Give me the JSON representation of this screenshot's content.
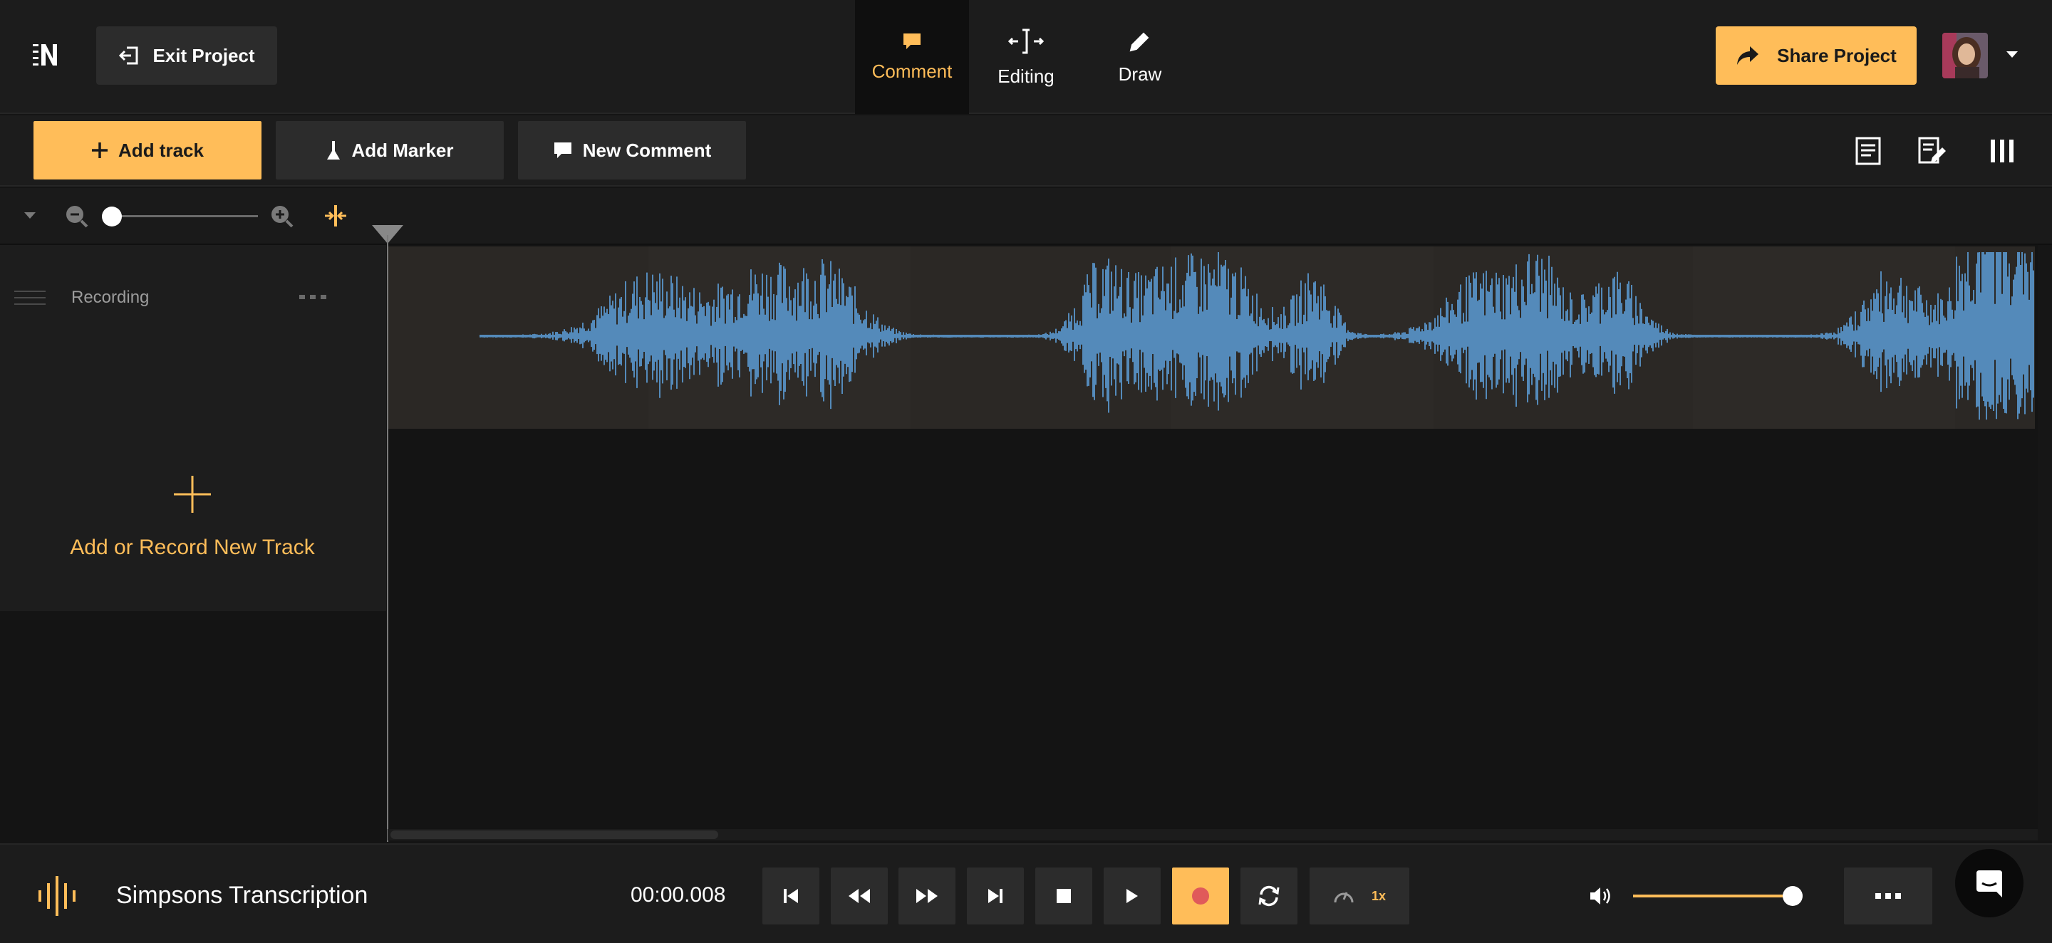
{
  "header": {
    "exit_label": "Exit Project",
    "tabs": [
      {
        "label": "Comment",
        "icon": "comment-icon",
        "active": true
      },
      {
        "label": "Editing",
        "icon": "split-edit-icon",
        "active": false
      },
      {
        "label": "Draw",
        "icon": "pencil-icon",
        "active": false
      }
    ],
    "share_label": "Share Project",
    "user_menu_icon": "caret-down-icon"
  },
  "toolbar": {
    "add_track_label": "Add track",
    "add_marker_label": "Add Marker",
    "new_comment_label": "New Comment",
    "right_icons": [
      "transcript-icon",
      "edit-notes-icon",
      "columns-icon"
    ]
  },
  "zoom": {
    "level": 0.05,
    "icons": [
      "collapse-caret-icon",
      "zoom-out-icon",
      "zoom-in-icon",
      "fit-timeline-icon"
    ]
  },
  "tracks": [
    {
      "name": "Recording"
    }
  ],
  "add_record_label": "Add or Record New Track",
  "transport": {
    "project_title": "Simpsons Transcription",
    "timecode": "00:00.008",
    "speed": "1x",
    "volume": 1.0,
    "buttons": [
      "skip-to-start-icon",
      "rewind-icon",
      "fast-forward-icon",
      "skip-to-end-icon",
      "stop-icon",
      "play-icon",
      "record-icon",
      "loop-icon",
      "speed-gauge-icon"
    ]
  },
  "colors": {
    "accent": "#ffbd59",
    "waveform": "#5ea3e0",
    "record": "#e05a5a",
    "background": "#141414",
    "panel": "#1c1c1c"
  }
}
